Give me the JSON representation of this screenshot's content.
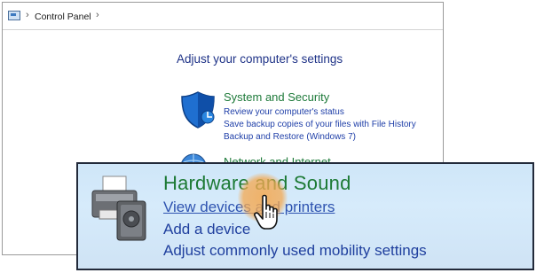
{
  "address_bar": {
    "icon": "control-panel-icon",
    "separator": "›",
    "crumbs": [
      "Control Panel"
    ]
  },
  "main": {
    "heading": "Adjust your computer's settings",
    "categories": [
      {
        "icon": "shield-icon",
        "title": "System and Security",
        "links": [
          "Review your computer's status",
          "Save backup copies of your files with File History",
          "Backup and Restore (Windows 7)"
        ]
      },
      {
        "icon": "globe-icon",
        "title": "Network and Internet"
      }
    ]
  },
  "callout": {
    "icon": "printer-icon",
    "title": "Hardware and Sound",
    "links": [
      "View devices and printers",
      "Add a device",
      "Adjust commonly used mobility settings"
    ],
    "cursor": "hand-pointer-icon",
    "highlight_color": "#f4a850"
  },
  "colors": {
    "category_title": "#1e7a3a",
    "link": "#1f3fa8",
    "heading": "#1e3287",
    "callout_bg": "#d2e7f9"
  }
}
